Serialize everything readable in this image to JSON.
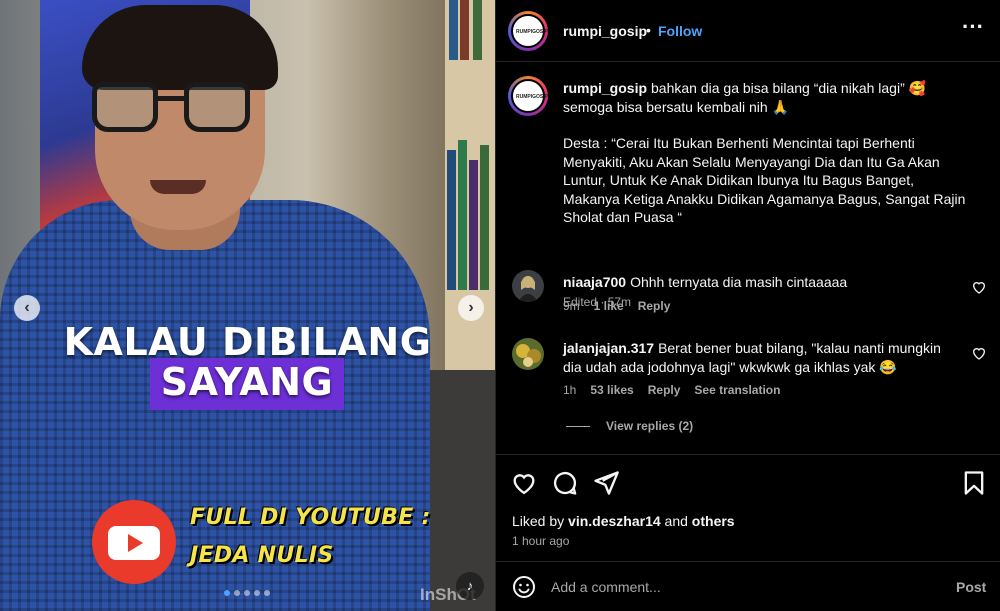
{
  "media": {
    "caption_line1": "KALAU DIBILANG",
    "caption_line2": "SAYANG",
    "promo_line1": "FULL DI YOUTUBE :",
    "promo_line2": "JEDA NULIS",
    "watermark": "InShOt",
    "prev_icon": "chevron-left-icon",
    "next_icon": "chevron-right-icon",
    "slide_count": 5,
    "active_slide": 1,
    "accent_caption_bg": "#6d2fd6",
    "promo_color": "#f4e34a"
  },
  "header": {
    "username": "rumpi_gosip",
    "separator": "•",
    "follow_label": "Follow",
    "more_icon": "more-horizontal-icon",
    "follow_color": "#4ea3ff"
  },
  "caption": {
    "username": "rumpi_gosip",
    "line1": "bahkan dia ga bisa bilang “dia nikah lagi” 🥰",
    "line2": "semoga bisa bersatu kembali nih 🙏",
    "quote": "Desta : “Cerai Itu Bukan Berhenti Mencintai tapi Berhenti Menyakiti, Aku Akan Selalu Menyayangi Dia dan Itu Ga Akan Luntur, Untuk Ke Anak Didikan Ibunya Itu Bagus Banget, Makanya Ketiga Anakku Didikan Agamanya Bagus, Sangat Rajin Sholat dan Puasa “",
    "meta": "Edited · 57m"
  },
  "comments": [
    {
      "username": "niaaja700",
      "text": "Ohhh ternyata dia masih cintaaaaa",
      "time": "9m",
      "likes": "1 like",
      "reply": "Reply"
    },
    {
      "username": "jalanjajan.317",
      "text": "Berat bener buat bilang, \"kalau nanti mungkin dia udah ada jodohnya lagi\" wkwkwk ga ikhlas yak 😂",
      "time": "1h",
      "likes": "53 likes",
      "reply": "Reply",
      "translate": "See translation"
    }
  ],
  "view_replies": "View replies (2)",
  "actions": {
    "like_icon": "heart-icon",
    "comment_icon": "comment-icon",
    "share_icon": "send-icon",
    "save_icon": "bookmark-icon",
    "liked_prefix": "Liked by",
    "liked_user": "vin.deszhar14",
    "liked_and": "and",
    "liked_others": "others",
    "time": "1 hour ago"
  },
  "composer": {
    "emoji_icon": "smiley-icon",
    "placeholder": "Add a comment...",
    "value": "",
    "post_label": "Post"
  }
}
